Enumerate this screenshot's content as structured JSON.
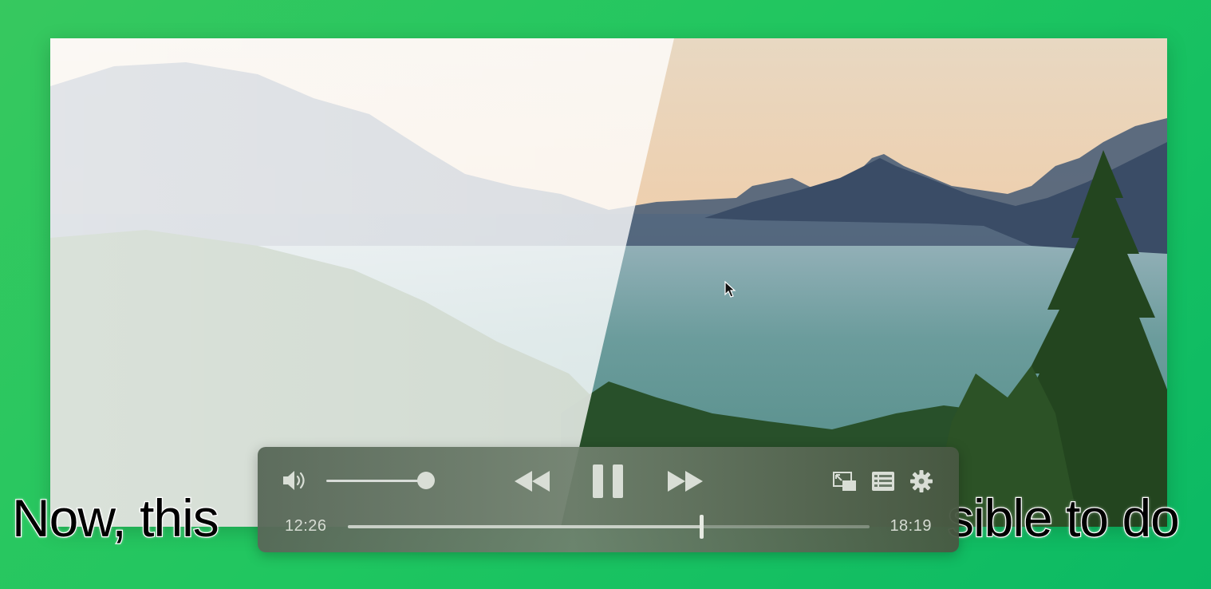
{
  "subtitle": {
    "left_text": "Now, this",
    "right_text": "sible to do"
  },
  "player": {
    "current_time": "12:26",
    "duration": "18:19",
    "progress": 0.678,
    "volume": 1.0,
    "state": "playing",
    "icons": {
      "volume": "speaker-icon",
      "rewind": "rewind-icon",
      "play_pause": "pause-icon",
      "forward": "fast-forward-icon",
      "pip": "picture-in-picture-icon",
      "chapters": "list-icon",
      "settings": "gear-icon"
    }
  },
  "colors": {
    "background": "#1fc660",
    "controls_bg": "#6a7a68",
    "control_glyph": "#d9ded6"
  }
}
